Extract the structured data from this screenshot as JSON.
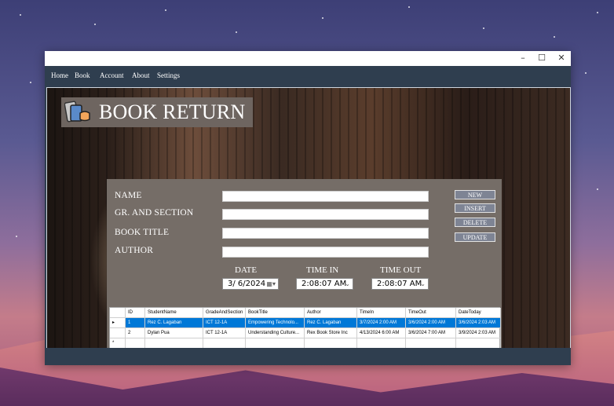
{
  "window": {
    "minimize_glyph": "–",
    "maximize_glyph": "☐",
    "close_glyph": "✕"
  },
  "menu": [
    {
      "label": "Home"
    },
    {
      "label": "Book"
    },
    {
      "label": "Account"
    },
    {
      "label": "About"
    },
    {
      "label": "Settings"
    }
  ],
  "header": {
    "title": "BOOK RETURN",
    "logo_icon": "book-return-icon"
  },
  "form": {
    "labels": {
      "name": "NAME",
      "section": "GR. AND SECTION",
      "book_title": "BOOK TITLE",
      "author": "AUTHOR"
    },
    "values": {
      "name": "",
      "section": "",
      "book_title": "",
      "author": ""
    }
  },
  "actions": {
    "new": "NEW",
    "insert": "INSERT",
    "delete": "DELETE",
    "update": "UPDATE"
  },
  "datetime": {
    "date_label": "DATE",
    "time_in_label": "TIME IN",
    "time_out_label": "TIME OUT",
    "date_value": "3/  6/2024",
    "time_in_value": "2:08:07 AM",
    "time_out_value": "2:08:07 AM",
    "calendar_glyph": "▦▾",
    "dropdown_glyph": "⌄"
  },
  "grid": {
    "columns": [
      "ID",
      "StudentName",
      "GradeAndSection",
      "BookTitle",
      "Author",
      "TimeIn",
      "TimeOut",
      "DateToday"
    ],
    "rows": [
      {
        "indicator": "▸",
        "cells": [
          "1",
          "Rez C. Lagaban",
          "ICT 12-1A",
          "Empowering Technolo...",
          "Rez C. Lagaban",
          "3/7/2024 2:00 AM",
          "3/6/2024 2:00 AM",
          "3/6/2024 2:03 AM"
        ]
      },
      {
        "indicator": "",
        "cells": [
          "2",
          "Dylan Pua",
          "ICT 12-1A",
          "Understanding Culture...",
          "Rex Book Store Inc",
          "4/13/2024 6:00 AM",
          "3/6/2024 7:00 AM",
          "3/9/2024 2:03 AM"
        ]
      }
    ],
    "new_row_indicator": "*"
  },
  "colors": {
    "accent": "#0078d7",
    "panel": "#756d67",
    "window_frame": "#2f3e4f"
  }
}
